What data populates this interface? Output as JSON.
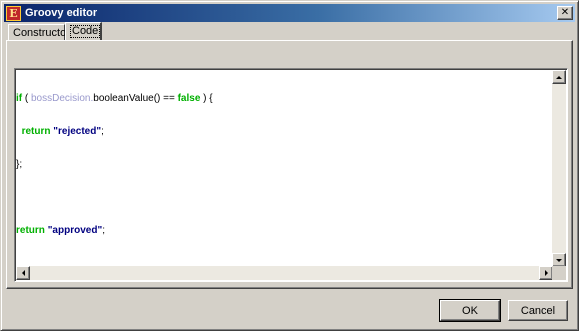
{
  "window": {
    "title": "Groovy editor",
    "app_icon_glyph": "E",
    "close_glyph": "✕"
  },
  "tabs": [
    {
      "label": "Constructor",
      "selected": false
    },
    {
      "label": "Code",
      "selected": true
    }
  ],
  "editor": {
    "language": "groovy",
    "code_lines": [
      "if ( bossDecision.booleanValue() == false ) {",
      "  return \"rejected\";",
      "};",
      "",
      "return \"approved\";"
    ],
    "tokens": {
      "if": "if",
      "var": "bossDecision.",
      "method": "booleanValue() ==",
      "false": "false",
      "open": " ) {",
      "return": "return",
      "rejected": "\"rejected\"",
      "semicolon": ";",
      "close": "};",
      "approved": "\"approved\""
    },
    "colors": {
      "keyword": "#00b000",
      "variable": "#9999cc",
      "string": "#000080"
    }
  },
  "buttons": {
    "ok": "OK",
    "cancel": "Cancel"
  },
  "icons": {
    "scroll_up": "triangle-up",
    "scroll_down": "triangle-down",
    "scroll_left": "triangle-left",
    "scroll_right": "triangle-right"
  }
}
